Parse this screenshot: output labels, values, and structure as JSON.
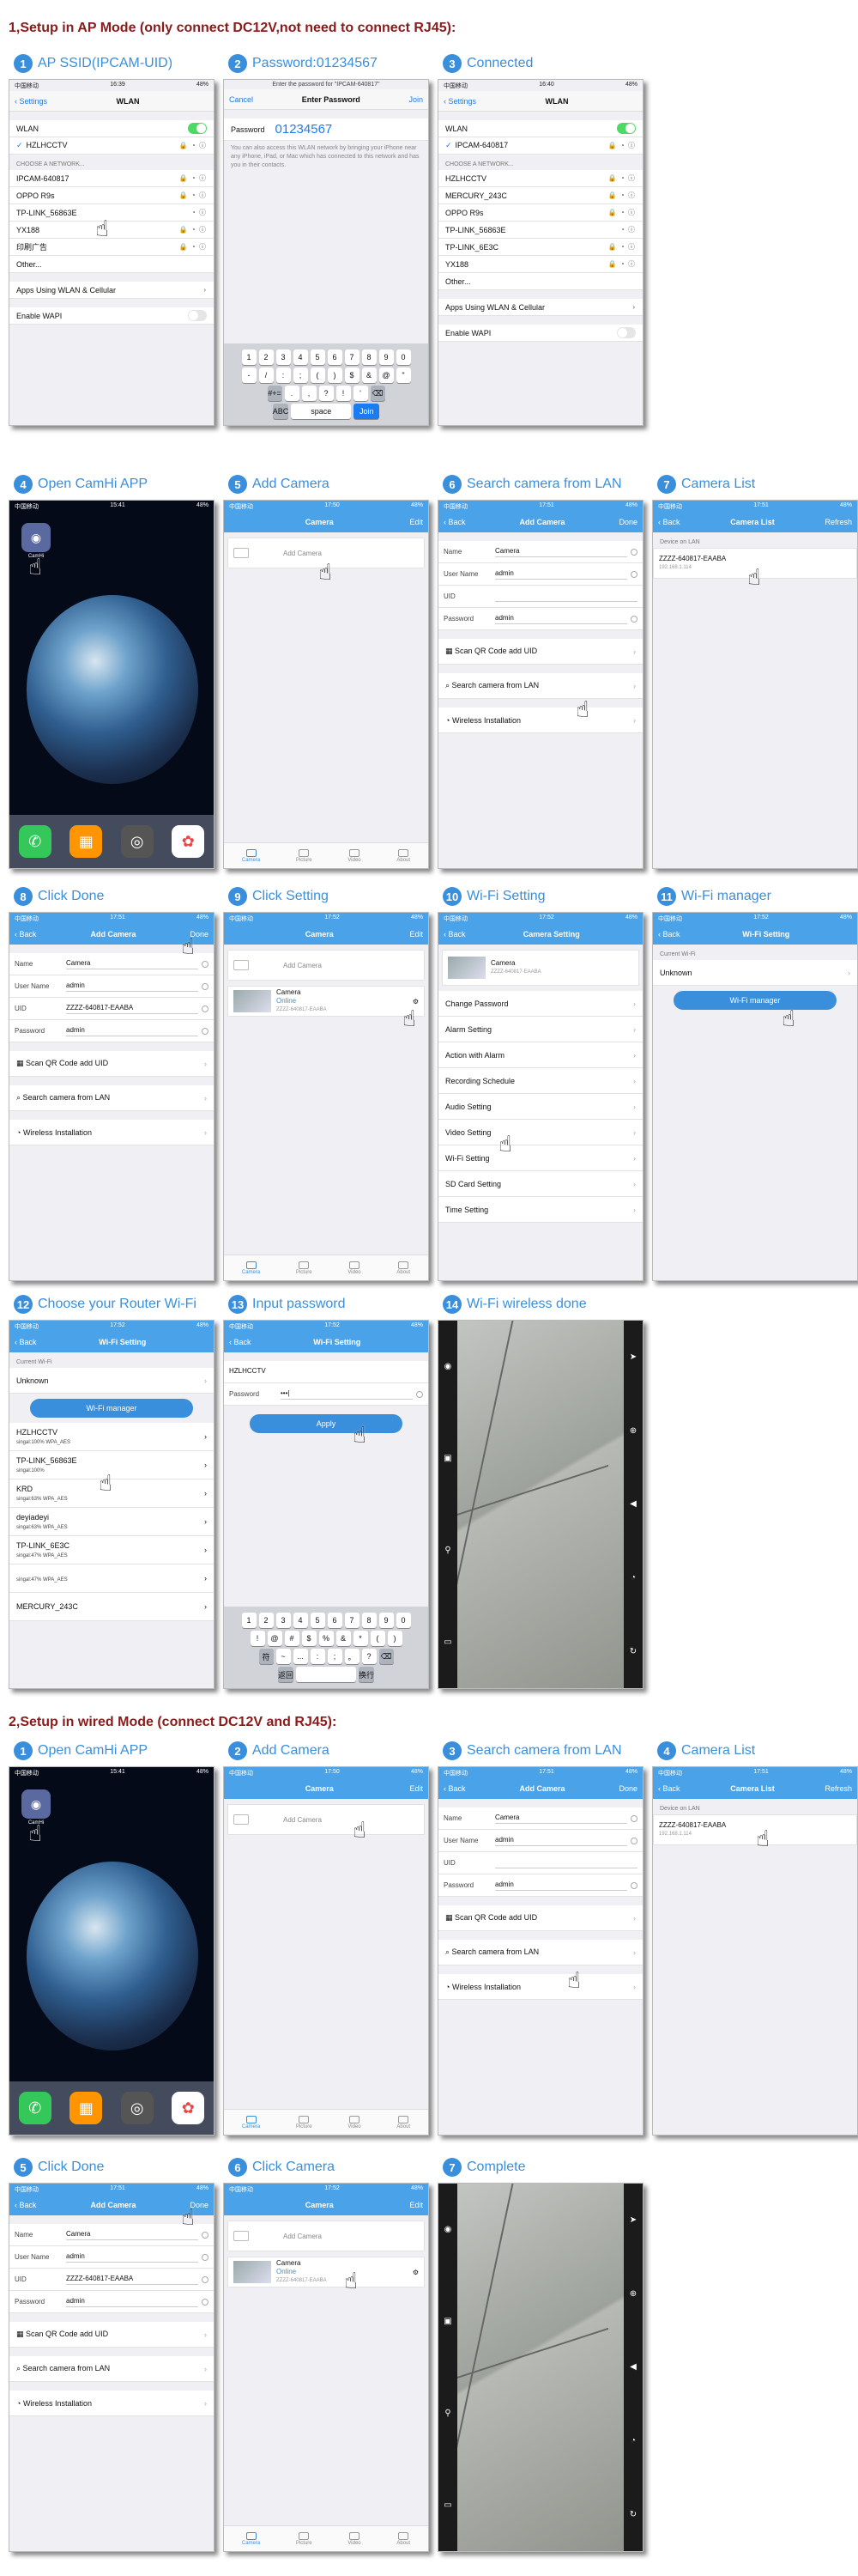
{
  "section1": {
    "title": "1,Setup in AP Mode  (only connect DC12V,not need to connect RJ45):"
  },
  "section2": {
    "title": "2,Setup in wired Mode (connect DC12V and RJ45):"
  },
  "s1": [
    {
      "num": "1",
      "label": "AP SSID(IPCAM-UID)"
    },
    {
      "num": "2",
      "label": "Password:01234567"
    },
    {
      "num": "3",
      "label": "Connected"
    },
    {
      "num": "4",
      "label": "Open CamHi APP"
    },
    {
      "num": "5",
      "label": "Add Camera"
    },
    {
      "num": "6",
      "label": "Search camera from LAN"
    },
    {
      "num": "7",
      "label": "Camera List"
    },
    {
      "num": "8",
      "label": "Click Done"
    },
    {
      "num": "9",
      "label": "Click Setting"
    },
    {
      "num": "10",
      "label": "Wi-Fi Setting"
    },
    {
      "num": "11",
      "label": "Wi-Fi manager"
    },
    {
      "num": "12",
      "label": "Choose your Router Wi-Fi"
    },
    {
      "num": "13",
      "label": "Input password"
    },
    {
      "num": "14",
      "label": "Wi-Fi wireless done"
    }
  ],
  "s2": [
    {
      "num": "1",
      "label": "Open CamHi APP"
    },
    {
      "num": "2",
      "label": "Add Camera"
    },
    {
      "num": "3",
      "label": "Search camera from LAN"
    },
    {
      "num": "4",
      "label": "Camera List"
    },
    {
      "num": "5",
      "label": "Click Done"
    },
    {
      "num": "6",
      "label": "Click Camera"
    },
    {
      "num": "7",
      "label": "Complete"
    }
  ],
  "status": {
    "left": "中国移动",
    "time1": "16:39",
    "time2": "16:40",
    "time3": "15:41",
    "time4": "17:50",
    "time5": "17:51",
    "time6": "17:52",
    "battery": "48%"
  },
  "wlan": {
    "back": "Settings",
    "title": "WLAN",
    "wlan_label": "WLAN",
    "connected": "HZLHCCTV",
    "connected2": "IPCAM-640817",
    "choose": "CHOOSE A NETWORK...",
    "networks1": [
      "IPCAM-640817",
      "OPPO R9s",
      "TP-LINK_56863E",
      "YX188",
      "印刷广告",
      "Other..."
    ],
    "networks3": [
      "HZLHCCTV",
      "MERCURY_243C",
      "OPPO R9s",
      "TP-LINK_56863E",
      "TP-LINK_6E3C",
      "YX188",
      "Other..."
    ],
    "apps": "Apps Using WLAN & Cellular",
    "wapi": "Enable WAPI"
  },
  "password": {
    "cancel": "Cancel",
    "title": "Enter Password",
    "join": "Join",
    "prompt": "Enter the password for \"IPCAM-640817\"",
    "label": "Password",
    "value": "01234567",
    "note": "You can also access this WLAN network by bringing your iPhone near any iPhone, iPad, or Mac which has connected to this network and has you in their contacts.",
    "keys_row1": [
      "1",
      "2",
      "3",
      "4",
      "5",
      "6",
      "7",
      "8",
      "9",
      "0"
    ],
    "keys_row2": [
      "-",
      "/",
      ":",
      ";",
      "(",
      ")",
      "$",
      "&",
      "@",
      "\""
    ],
    "keys_row3": [
      "#+=",
      ".",
      ",",
      "?",
      "!",
      "'",
      "⌫"
    ],
    "abc": "ABC",
    "space": "space",
    "join_key": "Join"
  },
  "camhi": {
    "app_name": "CamHi",
    "camera_title": "Camera",
    "edit": "Edit",
    "add_camera": "Add Camera",
    "back": "Back",
    "done": "Done",
    "name_label": "Name",
    "name_val": "Camera",
    "user_label": "User Name",
    "user_val": "admin",
    "uid_label": "UID",
    "uid_val": "ZZZZ-640817-EAABA",
    "pw_label": "Password",
    "pw_val": "admin",
    "scan": "Scan QR Code add UID",
    "search": "Search camera from LAN",
    "wireless": "Wireless Installation",
    "list_title": "Camera List",
    "refresh": "Refresh",
    "device_on_lan": "Device on LAN",
    "found_uid": "ZZZZ-640817-EAABA",
    "found_ip": "192.168.1.114",
    "cam_name": "Camera",
    "online": "Online",
    "cam_uid": "ZZZZ-640817-EAABA",
    "tabs": [
      "Camera",
      "Picture",
      "Video",
      "About"
    ]
  },
  "settings": {
    "title": "Camera Setting",
    "cam_name": "Camera",
    "cam_uid": "ZZZZ-640817-EAABA",
    "items": [
      "Change Password",
      "Alarm Setting",
      "Action with Alarm",
      "Recording Schedule",
      "Audio Setting",
      "Video Setting",
      "Wi-Fi Setting",
      "SD Card Setting",
      "Time Setting"
    ]
  },
  "wifi": {
    "title": "Wi-Fi Setting",
    "current": "Current Wi-Fi",
    "unknown": "Unknown",
    "manager": "Wi-Fi manager",
    "list": [
      {
        "ssid": "HZLHCCTV",
        "signal": "singal:100%",
        "sec": "WPA_AES"
      },
      {
        "ssid": "TP-LINK_56863E",
        "signal": "singal:100%",
        "sec": ""
      },
      {
        "ssid": "KRD",
        "signal": "singal:63%",
        "sec": "WPA_AES"
      },
      {
        "ssid": "deyiadeyi",
        "signal": "singal:63%",
        "sec": "WPA_AES"
      },
      {
        "ssid": "TP-LINK_6E3C",
        "signal": "singal:47%",
        "sec": "WPA_AES"
      },
      {
        "ssid": "",
        "signal": "singal:47%",
        "sec": "WPA_AES"
      },
      {
        "ssid": "MERCURY_243C",
        "signal": "",
        "sec": ""
      }
    ],
    "ssid_val": "HZLHCCTV",
    "pw_label": "Password",
    "pw_val": "•••|",
    "apply": "Apply",
    "kb_row1": [
      "1",
      "2",
      "3",
      "4",
      "5",
      "6",
      "7",
      "8",
      "9",
      "0"
    ],
    "kb_row2": [
      "!",
      "@",
      "#",
      "$",
      "%",
      "&",
      "*",
      "(",
      ")"
    ],
    "kb_row3": [
      "符",
      "~",
      "...",
      ":",
      ";",
      "。",
      "?",
      "⌫"
    ],
    "kb_back": "返回",
    "kb_enter": "换行"
  }
}
